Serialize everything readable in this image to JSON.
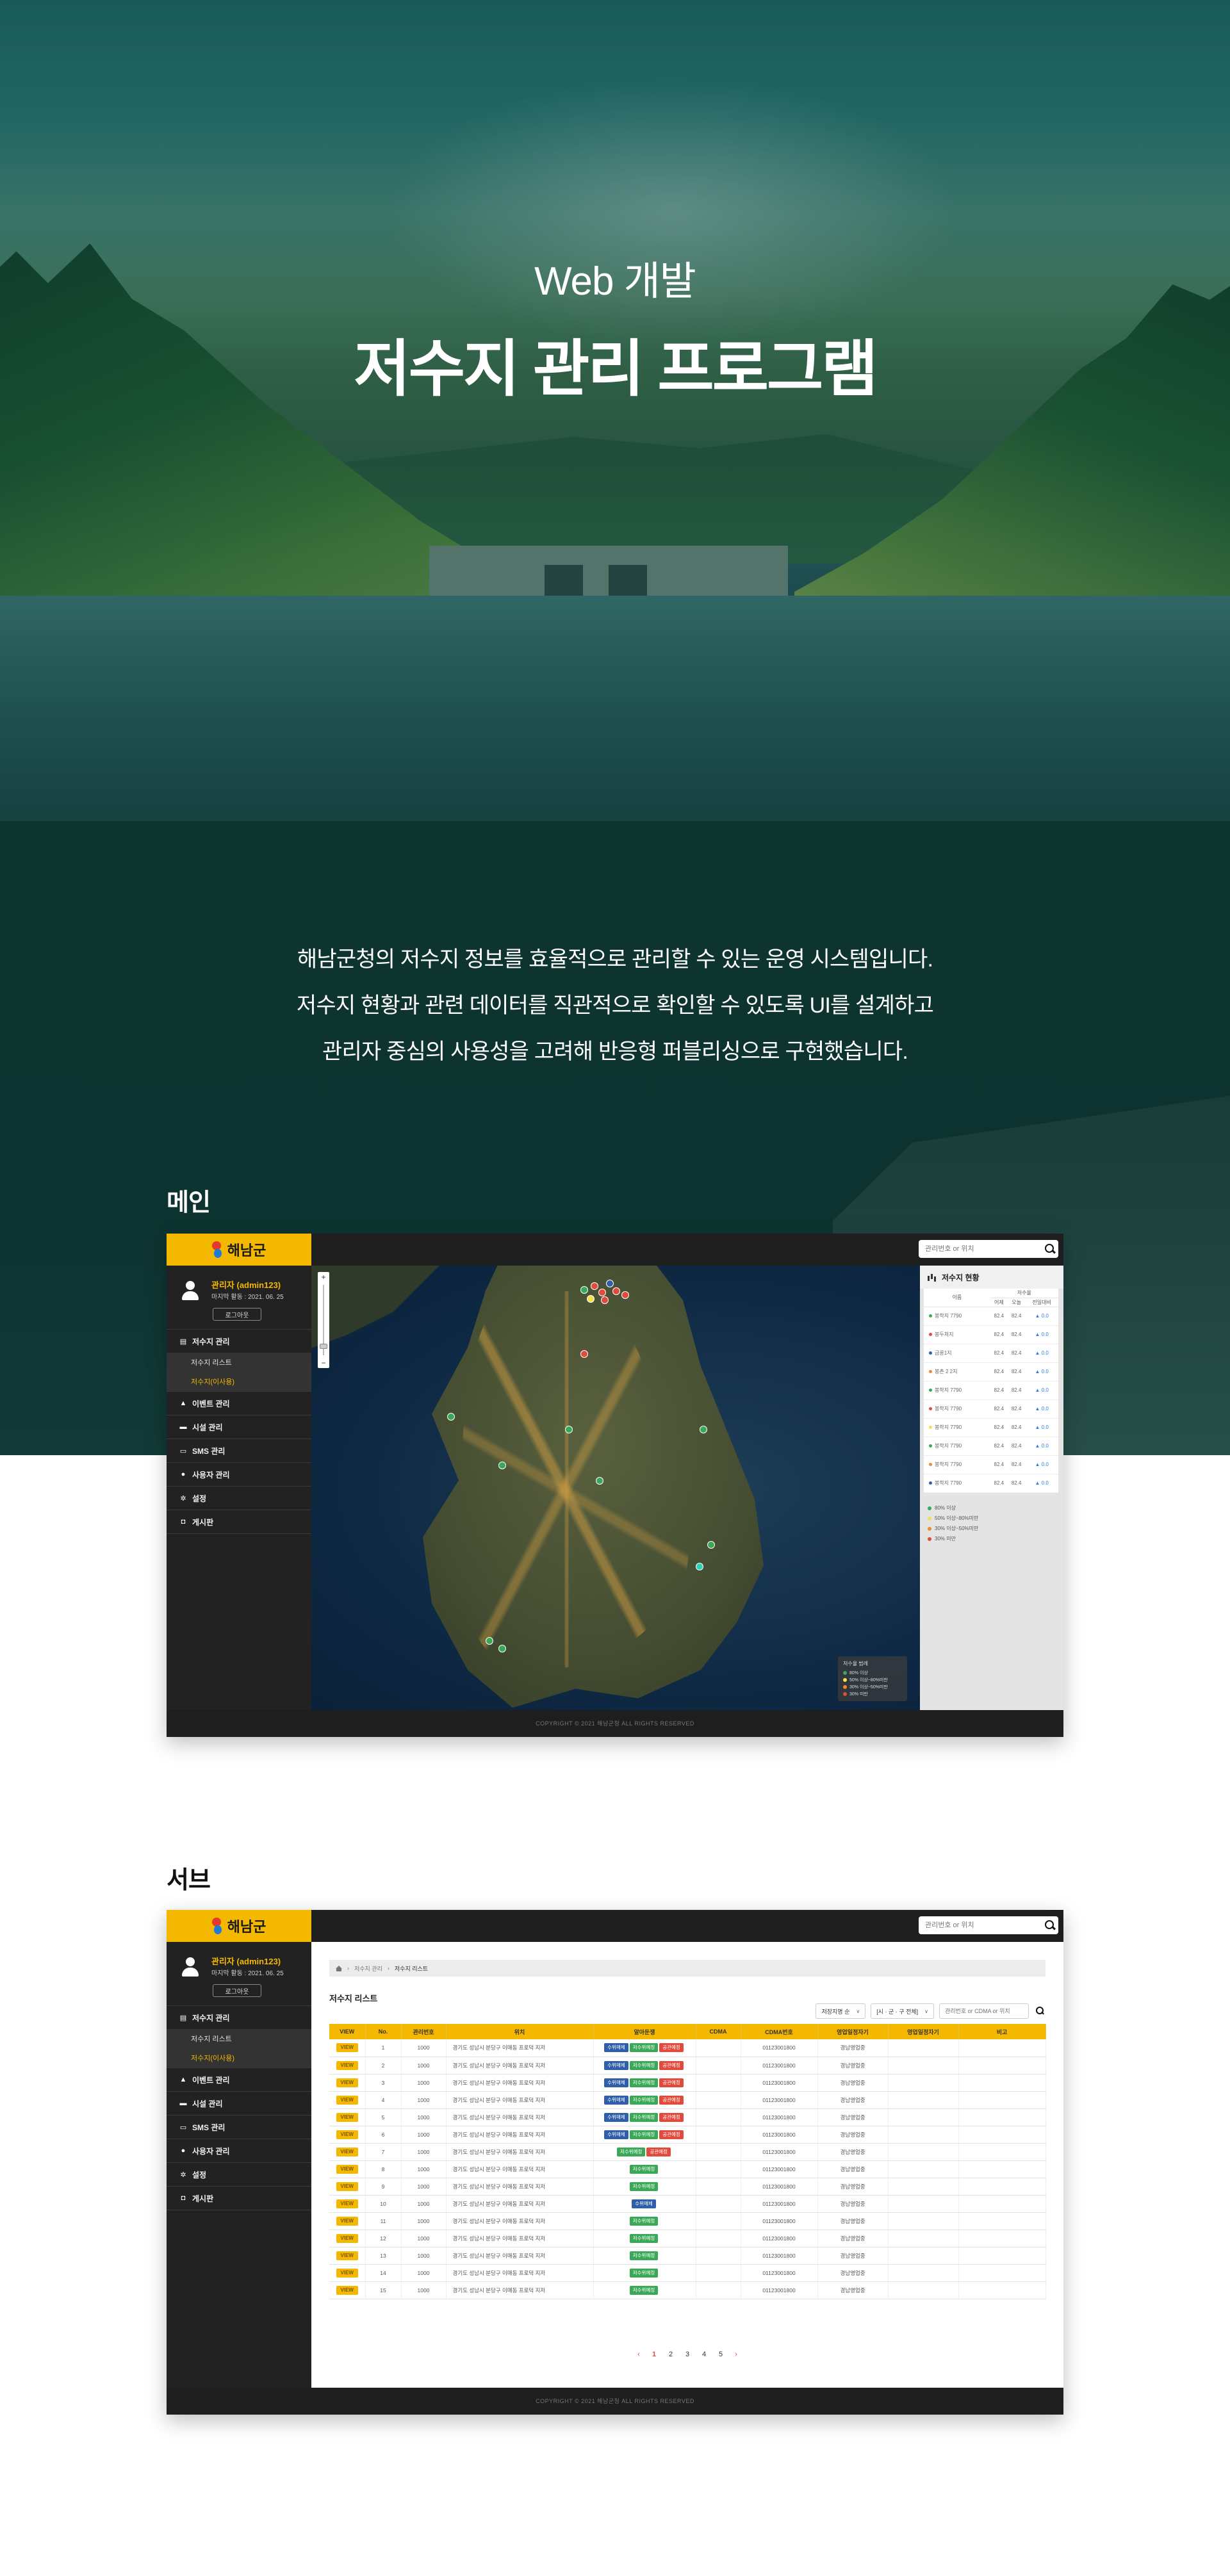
{
  "hero": {
    "subtitle": "Web 개발",
    "title": "저수지 관리 프로그램"
  },
  "intro": {
    "lines": [
      "해남군청의 저수지 정보를 효율적으로 관리할 수 있는 운영 시스템입니다.",
      "저수지 현황과 관련 데이터를 직관적으로 확인할 수 있도록 UI를 설계하고",
      "관리자 중심의 사용성을 고려해 반응형 퍼블리싱으로 구현했습니다."
    ]
  },
  "sections": {
    "main_title": "메인",
    "sub_title": "서브"
  },
  "app": {
    "logo": "해남군",
    "user_name": "관리자 (admin123)",
    "last_login": "마지막 활동 : 2021. 06. 25",
    "logout": "로그아웃",
    "search_placeholder": "관리번호 or 위치",
    "footer": "COPYRIGHT © 2021 해남군청 ALL RIGHTS RESERVED",
    "menu": {
      "reservoir": "저수지 관리",
      "reservoir_list": "저수지 리스트",
      "reservoir_detail": "저수지(이사용)",
      "event": "이벤트 관리",
      "facility": "시설 관리",
      "sms": "SMS 관리",
      "user": "사용자 관리",
      "settings": "설정",
      "board": "게시판"
    },
    "colors": {
      "accent": "#f5b800",
      "sidebar": "#222222",
      "blue": "#2e5fa8",
      "green": "#3aa856",
      "red": "#e24b3c"
    }
  },
  "main": {
    "zoom_in": "+",
    "zoom_out": "−",
    "map_legend": {
      "title": "저수율 범례",
      "items": [
        {
          "label": "80% 이상",
          "color": "#3aa856"
        },
        {
          "label": "50% 이상~80%미만",
          "color": "#f5e04a"
        },
        {
          "label": "30% 이상~50%미만",
          "color": "#f08a2a"
        },
        {
          "label": "30% 미만",
          "color": "#e24b3c"
        }
      ]
    },
    "status": {
      "title": "저수지 현황",
      "col_name": "이름",
      "col_group": "저수율",
      "col_a": "어제",
      "col_b": "오늘",
      "col_c": "전일대비",
      "rows": [
        {
          "name": "봉학지 7790",
          "a": "82.4",
          "b": "82.4",
          "c": "▲ 0.0",
          "color": "#3aa856"
        },
        {
          "name": "봉두쳐지",
          "a": "82.4",
          "b": "82.4",
          "c": "▲ 0.0",
          "color": "#e24b3c"
        },
        {
          "name": "금릉1지",
          "a": "82.4",
          "b": "82.4",
          "c": "▲ 0.0",
          "color": "#2e5fa8"
        },
        {
          "name": "봉촌 2 2지",
          "a": "82.4",
          "b": "82.4",
          "c": "▲ 0.0",
          "color": "#f08a2a"
        },
        {
          "name": "봉학지 7790",
          "a": "82.4",
          "b": "82.4",
          "c": "▲ 0.0",
          "color": "#3aa856"
        },
        {
          "name": "봉학지 7790",
          "a": "82.4",
          "b": "82.4",
          "c": "▲ 0.0",
          "color": "#e24b3c"
        },
        {
          "name": "봉학지 7790",
          "a": "82.4",
          "b": "82.4",
          "c": "▲ 0.0",
          "color": "#f5e04a"
        },
        {
          "name": "봉학지 7790",
          "a": "82.4",
          "b": "82.4",
          "c": "▲ 0.0",
          "color": "#3aa856"
        },
        {
          "name": "봉학지 7790",
          "a": "82.4",
          "b": "82.4",
          "c": "▲ 0.0",
          "color": "#f08a2a"
        },
        {
          "name": "봉학지 7790",
          "a": "82.4",
          "b": "82.4",
          "c": "▲ 0.0",
          "color": "#2e5fa8"
        }
      ],
      "legend": [
        {
          "label": "80% 이상",
          "color": "#3aa856"
        },
        {
          "label": "50% 이상~80%미만",
          "color": "#f5e04a"
        },
        {
          "label": "30% 이상~50%미만",
          "color": "#f08a2a"
        },
        {
          "label": "30% 미만",
          "color": "#e24b3c"
        }
      ]
    }
  },
  "sub": {
    "breadcrumb": [
      "저수지 관리",
      "저수지 리스트"
    ],
    "page_title": "저수지 리스트",
    "filter_1": "저장지명 순",
    "filter_2": "[시 · 군 · 구 전체]",
    "keyword_placeholder": "관리번호 or CDMA or 위치",
    "headers": [
      "VIEW",
      "No.",
      "관리번호",
      "위치",
      "알아둔쟁",
      "CDMA",
      "CDMA번호",
      "영업일정자기",
      "영업일정자기",
      "비고"
    ],
    "view_label": "VIEW",
    "rows": [
      {
        "no": "1",
        "code": "1000",
        "addr": "경기도 성남시 분당구 이매동 프로덕 지저",
        "badges": [
          "blue",
          "green",
          "red"
        ],
        "cdma": "01123001800",
        "date": "경남영업중"
      },
      {
        "no": "2",
        "code": "1000",
        "addr": "경기도 성남시 분당구 이매동 프로덕 지저",
        "badges": [
          "blue",
          "green",
          "red"
        ],
        "cdma": "01123001800",
        "date": "경남영업중"
      },
      {
        "no": "3",
        "code": "1000",
        "addr": "경기도 성남시 분당구 이매동 프로덕 지저",
        "badges": [
          "blue",
          "green",
          "red"
        ],
        "cdma": "01123001800",
        "date": "경남영업중"
      },
      {
        "no": "4",
        "code": "1000",
        "addr": "경기도 성남시 분당구 이매동 프로덕 지저",
        "badges": [
          "blue",
          "green",
          "red"
        ],
        "cdma": "01123001800",
        "date": "경남영업중"
      },
      {
        "no": "5",
        "code": "1000",
        "addr": "경기도 성남시 분당구 이매동 프로덕 지저",
        "badges": [
          "blue",
          "green",
          "red"
        ],
        "cdma": "01123001800",
        "date": "경남영업중"
      },
      {
        "no": "6",
        "code": "1000",
        "addr": "경기도 성남시 분당구 이매동 프로덕 지저",
        "badges": [
          "blue",
          "green",
          "red"
        ],
        "cdma": "01123001800",
        "date": "경남영업중"
      },
      {
        "no": "7",
        "code": "1000",
        "addr": "경기도 성남시 분당구 이매동 프로덕 지저",
        "badges": [
          "green",
          "red"
        ],
        "cdma": "01123001800",
        "date": "경남영업중"
      },
      {
        "no": "8",
        "code": "1000",
        "addr": "경기도 성남시 분당구 이매동 프로덕 지저",
        "badges": [
          "green"
        ],
        "cdma": "01123001800",
        "date": "경남영업중"
      },
      {
        "no": "9",
        "code": "1000",
        "addr": "경기도 성남시 분당구 이매동 프로덕 지저",
        "badges": [
          "green"
        ],
        "cdma": "01123001800",
        "date": "경남영업중"
      },
      {
        "no": "10",
        "code": "1000",
        "addr": "경기도 성남시 분당구 이매동 프로덕 지저",
        "badges": [
          "blue"
        ],
        "cdma": "01123001800",
        "date": "경남영업중"
      },
      {
        "no": "11",
        "code": "1000",
        "addr": "경기도 성남시 분당구 이매동 프로덕 지저",
        "badges": [
          "green"
        ],
        "cdma": "01123001800",
        "date": "경남영업중"
      },
      {
        "no": "12",
        "code": "1000",
        "addr": "경기도 성남시 분당구 이매동 프로덕 지저",
        "badges": [
          "green"
        ],
        "cdma": "01123001800",
        "date": "경남영업중"
      },
      {
        "no": "13",
        "code": "1000",
        "addr": "경기도 성남시 분당구 이매동 프로덕 지저",
        "badges": [
          "green"
        ],
        "cdma": "01123001800",
        "date": "경남영업중"
      },
      {
        "no": "14",
        "code": "1000",
        "addr": "경기도 성남시 분당구 이매동 프로덕 지저",
        "badges": [
          "green"
        ],
        "cdma": "01123001800",
        "date": "경남영업중"
      },
      {
        "no": "15",
        "code": "1000",
        "addr": "경기도 성남시 분당구 이매동 프로덕 지저",
        "badges": [
          "green"
        ],
        "cdma": "01123001800",
        "date": "경남영업중"
      }
    ],
    "badge_labels": {
      "blue": "수위매체",
      "green": "저수위예정",
      "red": "공관예정"
    },
    "pager": {
      "prev": "‹",
      "next": "›",
      "pages": [
        "1",
        "2",
        "3",
        "4",
        "5"
      ],
      "current": "1"
    }
  }
}
